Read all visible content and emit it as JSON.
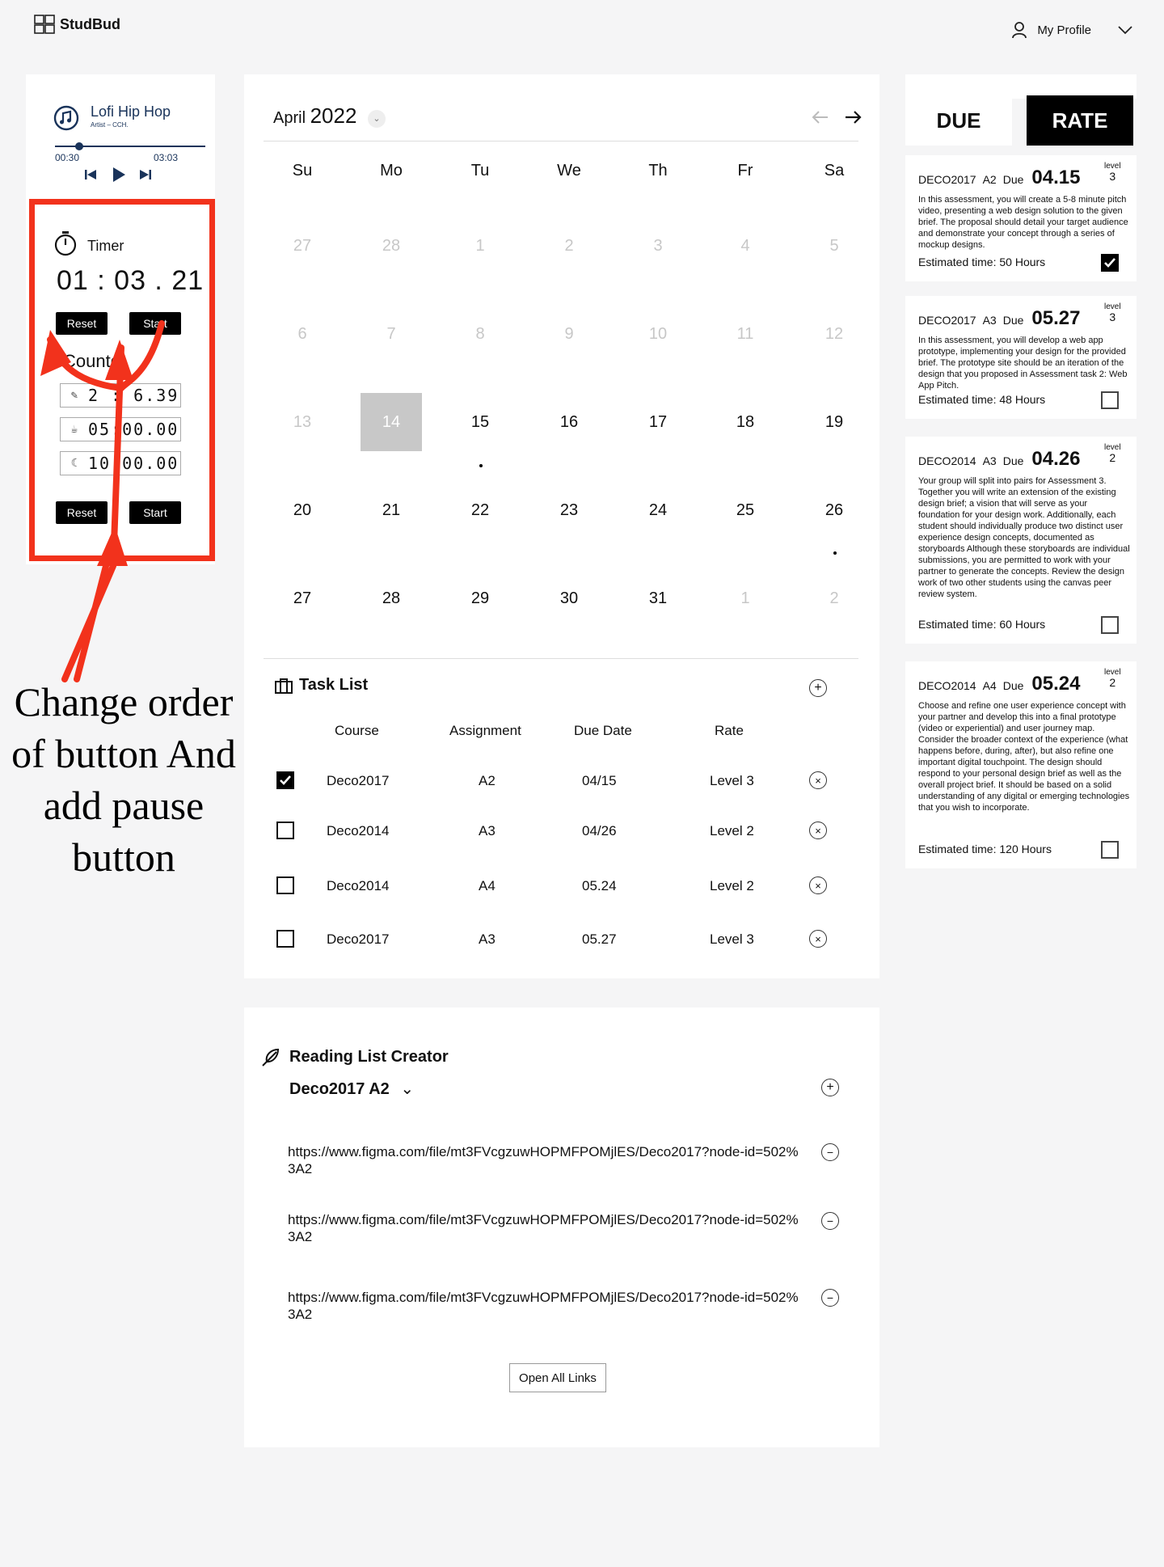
{
  "app": {
    "name": "StudBud"
  },
  "header": {
    "profile_label": "My Profile"
  },
  "music": {
    "title": "Lofi Hip Hop",
    "artist": "Artist – CCH.",
    "elapsed": "00:30",
    "duration": "03:03",
    "progress": 0.16
  },
  "timer": {
    "label": "Timer",
    "time": "01 : 03 . 21",
    "reset_label": "Reset",
    "start_label": "Start",
    "countdown_label": "Countd",
    "rows": [
      "2 : 6.39",
      "05:00.00",
      "10:00.00"
    ],
    "reset2_label": "Reset",
    "start2_label": "Start"
  },
  "annotation": {
    "text": "Change order of button And add pause button"
  },
  "calendar": {
    "month": "April",
    "year": "2022",
    "weekdays": [
      "Su",
      "Mo",
      "Tu",
      "We",
      "Th",
      "Fr",
      "Sa"
    ],
    "weeks": [
      [
        "27",
        "28",
        "1",
        "2",
        "3",
        "4",
        "5"
      ],
      [
        "6",
        "7",
        "8",
        "9",
        "10",
        "11",
        "12"
      ],
      [
        "13",
        "14",
        "15",
        "16",
        "17",
        "18",
        "19"
      ],
      [
        "20",
        "21",
        "22",
        "23",
        "24",
        "25",
        "26"
      ],
      [
        "27",
        "28",
        "29",
        "30",
        "31",
        "1",
        "2"
      ]
    ]
  },
  "tasks": {
    "title": "Task List",
    "headers": {
      "course": "Course",
      "assignment": "Assignment",
      "due": "Due Date",
      "rate": "Rate"
    },
    "rows": [
      {
        "course": "Deco2017",
        "assignment": "A2",
        "due": "04/15",
        "rate": "Level 3",
        "checked": true
      },
      {
        "course": "Deco2014",
        "assignment": "A3",
        "due": "04/26",
        "rate": "Level 2",
        "checked": false
      },
      {
        "course": "Deco2014",
        "assignment": "A4",
        "due": "05.24",
        "rate": "Level 2",
        "checked": false
      },
      {
        "course": "Deco2017",
        "assignment": "A3",
        "due": "05.27",
        "rate": "Level 3",
        "checked": false
      }
    ]
  },
  "reading": {
    "title": "Reading List Creator",
    "selected": "Deco2017 A2",
    "links": [
      "https://www.figma.com/file/mt3FVcgzuwHOPMFPOMjlES/Deco2017?node-id=502%3A2",
      "https://www.figma.com/file/mt3FVcgzuwHOPMFPOMjlES/Deco2017?node-id=502%3A2",
      "https://www.figma.com/file/mt3FVcgzuwHOPMFPOMjlES/Deco2017?node-id=502%3A2"
    ],
    "open_all_label": "Open All Links"
  },
  "right": {
    "tab_due": "DUE",
    "tab_rate": "RATE",
    "cards": [
      {
        "course": "DECO2017",
        "assignment": "A2",
        "due_label": "Due",
        "due": "04.15",
        "level_label": "level",
        "level": "3",
        "desc": "In this assessment, you will create a 5-8 minute pitch video, presenting a web design solution to the given brief. The proposal should detail your target audience and demonstrate your concept through a series of mockup designs.",
        "estimate": "Estimated time: 50 Hours",
        "checked": true
      },
      {
        "course": "DECO2017",
        "assignment": "A3",
        "due_label": "Due",
        "due": "05.27",
        "level_label": "level",
        "level": "3",
        "desc": "In this assessment, you will develop a web app prototype, implementing your design for the provided brief. The prototype site should be an iteration of the design that you proposed in Assessment task 2: Web App Pitch.",
        "estimate": "Estimated time: 48 Hours",
        "checked": false
      },
      {
        "course": "DECO2014",
        "assignment": "A3",
        "due_label": "Due",
        "due": "04.26",
        "level_label": "level",
        "level": "2",
        "desc": "Your group will split into pairs for Assessment 3. Together you will write an extension of the existing design brief; a vision that will serve as your foundation for your design work. Additionally, each student should individually produce two distinct user experience design concepts, documented as storyboards Although these storyboards are individual submissions, you are permitted to work with your partner to generate the concepts. Review the design work of two other students using the canvas peer review system.",
        "estimate": "Estimated time: 60 Hours",
        "checked": false
      },
      {
        "course": "DECO2014",
        "assignment": "A4",
        "due_label": "Due",
        "due": "05.24",
        "level_label": "level",
        "level": "2",
        "desc": "Choose and refine one user experience concept with your partner and develop this into a final prototype (video or experiential) and user journey map. Consider the broader context of the experience (what happens before, during, after), but also refine one important digital touchpoint. The design should respond to your personal design brief as well as the overall project brief. It should be based on a solid understanding of any digital or emerging technologies that you wish to incorporate.",
        "estimate": "Estimated time: 120 Hours",
        "checked": false
      }
    ]
  },
  "colors": {
    "accent_dark": "#19335a",
    "annotation_red": "#f2321c",
    "selected_day": "#c8c8c8"
  }
}
